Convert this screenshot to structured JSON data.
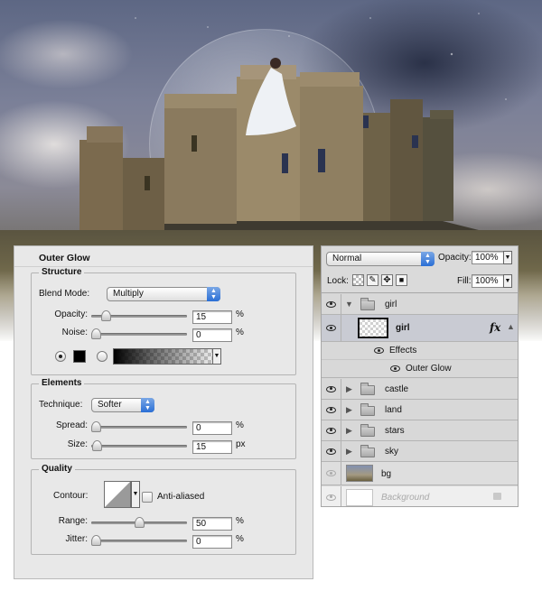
{
  "outer_glow": {
    "title": "Outer Glow",
    "structure": {
      "title": "Structure",
      "blend_mode_label": "Blend Mode:",
      "blend_mode_value": "Multiply",
      "opacity_label": "Opacity:",
      "opacity_value": "15",
      "opacity_level": 15,
      "noise_label": "Noise:",
      "noise_value": "0",
      "noise_level": 0,
      "unit": "%"
    },
    "elements": {
      "title": "Elements",
      "technique_label": "Technique:",
      "technique_value": "Softer",
      "spread_label": "Spread:",
      "spread_value": "0",
      "spread_level": 0,
      "spread_unit": "%",
      "size_label": "Size:",
      "size_value": "15",
      "size_level": 6,
      "size_unit": "px"
    },
    "quality": {
      "title": "Quality",
      "contour_label": "Contour:",
      "anti_aliased_label": "Anti-aliased",
      "range_label": "Range:",
      "range_value": "50",
      "range_level": 50,
      "range_unit": "%",
      "jitter_label": "Jitter:",
      "jitter_value": "0",
      "jitter_level": 0,
      "jitter_unit": "%"
    },
    "glow_color": "#000000"
  },
  "layers": {
    "blend_mode": "Normal",
    "opacity_label": "Opacity:",
    "opacity_value": "100%",
    "lock_label": "Lock:",
    "fill_label": "Fill:",
    "fill_value": "100%",
    "items": [
      {
        "name": "girl",
        "kind": "group",
        "expanded": true
      },
      {
        "name": "girl",
        "kind": "layer",
        "fx": "fx"
      },
      {
        "name": "Effects",
        "kind": "effects"
      },
      {
        "name": "Outer Glow",
        "kind": "effect"
      },
      {
        "name": "castle",
        "kind": "group"
      },
      {
        "name": "land",
        "kind": "group"
      },
      {
        "name": "stars",
        "kind": "group"
      },
      {
        "name": "sky",
        "kind": "group"
      },
      {
        "name": "bg",
        "kind": "layer"
      },
      {
        "name": "Background",
        "kind": "layer",
        "hidden": true
      }
    ]
  }
}
